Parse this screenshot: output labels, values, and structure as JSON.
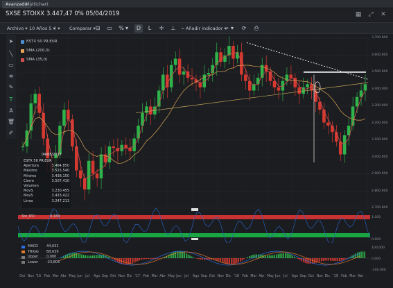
{
  "tabs": [
    {
      "label": "Avanzado",
      "active": true
    },
    {
      "label": "Multichart",
      "active": false
    }
  ],
  "title": "SXSE STOIXX 3.447,47 0% 05/04/2019",
  "toolbar": {
    "archivo": "Archivo",
    "periodo": "10 Años 5",
    "comparar": "Comparar",
    "percent_off": "%",
    "d": "D",
    "l": "L",
    "anadir": "Añadir indicador"
  },
  "legend": [
    {
      "label": "ESTX 50 PR.EUR",
      "color": "#4a8fd6"
    },
    {
      "label": "SMA (200,0)",
      "color": "#e8a55a"
    },
    {
      "label": "SMA (35,0)",
      "color": "#d45050"
    }
  ],
  "data_panel": {
    "date": "04/08/2017",
    "name": "ESTX 50 PR.EUR",
    "rows": [
      {
        "k": "Apertura",
        "v": "3.464,850"
      },
      {
        "k": "Máximo",
        "v": "3.515,540"
      },
      {
        "k": "Mínimo",
        "v": "3.438,150"
      },
      {
        "k": "Cierre",
        "v": "3.507,410"
      },
      {
        "k": "Volumen",
        "v": ""
      },
      {
        "k": "MovS",
        "v": "3.230,455"
      },
      {
        "k": "MovS",
        "v": "3.433,422"
      },
      {
        "k": "Línea",
        "v": "3.247,213"
      }
    ]
  },
  "rsi": {
    "label": "Sto_RSI",
    "value": "0,184",
    "colors": {
      "over": "#c83232",
      "under": "#1aa642",
      "mid": "#2a5fb8"
    }
  },
  "macd": {
    "rows": [
      {
        "k": "MACD",
        "v": "44,632",
        "color": "#2c6fe0"
      },
      {
        "k": "TRIGG",
        "v": "68,639",
        "color": "#e07a2c"
      },
      {
        "k": "Upper",
        "v": "0,000",
        "color": "#7a7a7a"
      },
      {
        "k": "Lower",
        "v": "-23,806",
        "color": "#7a7a7a"
      }
    ]
  },
  "y_axis": [
    "3.700.000",
    "3.600.000",
    "3.500.000",
    "3.400.000",
    "3.300.000",
    "3.200.000",
    "3.100.000",
    "3.000.000",
    "2.900.000",
    "2.800.000",
    "2.700.000"
  ],
  "rsi_axis": [
    "1.000",
    "0.000"
  ],
  "macd_axis": [
    "100.000",
    "0.000",
    "-100.000"
  ],
  "x_axis": [
    "Oct",
    "Nov",
    "'16",
    "Feb",
    "Mar",
    "Abr",
    "May",
    "Jun",
    "Jul",
    "Ago",
    "Sep",
    "Oct",
    "Nov",
    "Dic",
    "'17",
    "Feb",
    "Mar",
    "Abr",
    "May",
    "Jun",
    "Jul",
    "Ago",
    "Sep",
    "Oct",
    "Nov",
    "Dic",
    "'18",
    "Feb",
    "Mar",
    "Abr",
    "May",
    "Jun",
    "Jul",
    "Ago",
    "Sep",
    "Oct",
    "Nov",
    "Dic",
    "'19",
    "Feb",
    "Mar",
    "Abr"
  ],
  "chart_data": {
    "type": "candlestick",
    "closes": [
      3050,
      3150,
      3320,
      3380,
      3260,
      3100,
      2950,
      2900,
      3000,
      3180,
      3280,
      3220,
      3050,
      2900,
      2850,
      2780,
      2960,
      2880,
      2850,
      3000,
      2950,
      3050,
      3040,
      3020,
      3060,
      3040,
      3020,
      3100,
      3180,
      3260,
      3300,
      3250,
      3300,
      3400,
      3500,
      3420,
      3560,
      3600,
      3500,
      3520,
      3480,
      3470,
      3450,
      3420,
      3500,
      3510,
      3560,
      3640,
      3580,
      3620,
      3680,
      3600,
      3640,
      3500,
      3460,
      3400,
      3440,
      3480,
      3560,
      3520,
      3460,
      3420,
      3400,
      3460,
      3500,
      3480,
      3420,
      3380,
      3420,
      3440,
      3400,
      3330,
      3280,
      3200,
      3180,
      3140,
      3080,
      3000,
      3120,
      3180,
      3300,
      3360,
      3400,
      3440
    ]
  }
}
